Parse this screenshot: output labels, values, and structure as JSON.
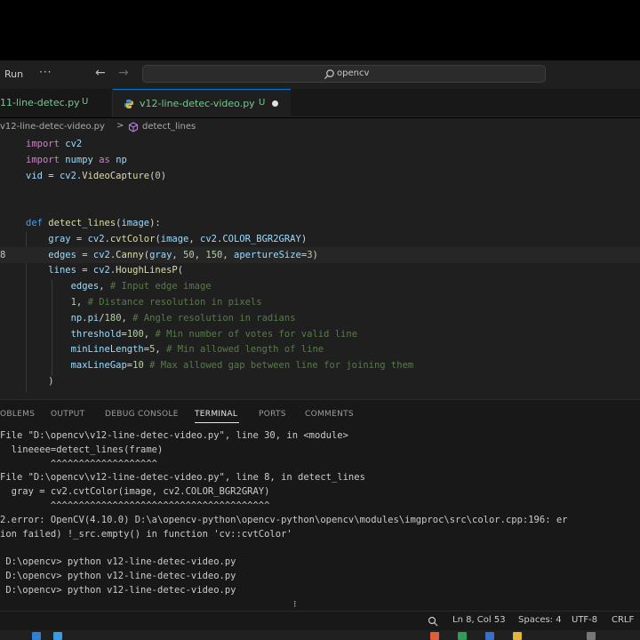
{
  "topbar": {
    "menu_run": "Run",
    "menu_more": "···",
    "nav_back": "←",
    "nav_forward": "→",
    "search_text": "opencv"
  },
  "tabs": [
    {
      "label": "11-line-detec.py",
      "status": "U"
    },
    {
      "label": "v12-line-detec-video.py",
      "status": "U"
    }
  ],
  "breadcrumb": {
    "file": "v12-line-detec-video.py",
    "sep": ">",
    "symbol": "detect_lines"
  },
  "code_lines": [
    {
      "num": "",
      "html": "<span class=\"kw\">import</span> <span class=\"var\">cv2</span>"
    },
    {
      "num": "",
      "html": "<span class=\"kw\">import</span> <span class=\"var\">numpy</span> <span class=\"kw\">as</span> <span class=\"var\">np</span>"
    },
    {
      "num": "",
      "html": "<span class=\"var\">vid</span> = <span class=\"var\">cv2</span>.<span class=\"fn\">VideoCapture</span>(<span class=\"num\">0</span>)"
    },
    {
      "num": "",
      "html": ""
    },
    {
      "num": "",
      "html": ""
    },
    {
      "num": "",
      "html": "<span class=\"kw2\">def</span> <span class=\"fn\">detect_lines</span>(<span class=\"var\">image</span>):"
    },
    {
      "num": "",
      "html": "    <span class=\"var\">gray</span> = <span class=\"var\">cv2</span>.<span class=\"fn\">cvtColor</span>(<span class=\"var\">image</span>, <span class=\"var\">cv2</span>.<span class=\"var\">COLOR_BGR2GRAY</span>)"
    },
    {
      "num": "8",
      "html": "    <span class=\"var\">edges</span> = <span class=\"var\">cv2</span>.<span class=\"fn\">Canny</span>(<span class=\"var\">gray</span>, <span class=\"num\">50</span>, <span class=\"num\">150</span>, <span class=\"var\">apertureSize</span>=<span class=\"num\">3</span>)"
    },
    {
      "num": "",
      "html": "    <span class=\"var\">lines</span> = <span class=\"var\">cv2</span>.<span class=\"fn\">HoughLinesP</span>("
    },
    {
      "num": "",
      "html": "        <span class=\"var\">edges</span>, <span class=\"cm\"># Input edge image</span>"
    },
    {
      "num": "",
      "html": "        <span class=\"num\">1</span>, <span class=\"cm\"># Distance resolution in pixels</span>"
    },
    {
      "num": "",
      "html": "        <span class=\"var\">np</span>.<span class=\"var\">pi</span>/<span class=\"num\">180</span>, <span class=\"cm\"># Angle resolution in radians</span>"
    },
    {
      "num": "",
      "html": "        <span class=\"var\">threshold</span>=<span class=\"num\">100</span>, <span class=\"cm\"># Min number of votes for valid line</span>"
    },
    {
      "num": "",
      "html": "        <span class=\"var\">minLineLength</span>=<span class=\"num\">5</span>, <span class=\"cm\"># Min allowed length of line</span>"
    },
    {
      "num": "",
      "html": "        <span class=\"var\">maxLineGap</span>=<span class=\"num\">10</span> <span class=\"cm\"># Max allowed gap between line for joining them</span>"
    },
    {
      "num": "",
      "html": "    )"
    }
  ],
  "panel_tabs": [
    {
      "label": "OBLEMS",
      "active": false
    },
    {
      "label": "OUTPUT",
      "active": false
    },
    {
      "label": "DEBUG CONSOLE",
      "active": false
    },
    {
      "label": "TERMINAL",
      "active": true
    },
    {
      "label": "PORTS",
      "active": false
    },
    {
      "label": "COMMENTS",
      "active": false
    }
  ],
  "terminal_lines": [
    "File \"D:\\opencv\\v12-line-detec-video.py\", line 30, in <module>",
    "  lineeee=detect_lines(frame)",
    "         ^^^^^^^^^^^^^^^^^^^",
    "File \"D:\\opencv\\v12-line-detec-video.py\", line 8, in detect_lines",
    "  gray = cv2.cvtColor(image, cv2.COLOR_BGR2GRAY)",
    "         ^^^^^^^^^^^^^^^^^^^^^^^^^^^^^^^^^^^^^^^",
    "2.error: OpenCV(4.10.0) D:\\a\\opencv-python\\opencv-python\\opencv\\modules\\imgproc\\src\\color.cpp:196: er",
    "ion failed) !_src.empty() in function 'cv::cvtColor'",
    "",
    " D:\\opencv> python v12-line-detec-video.py",
    " D:\\opencv> python v12-line-detec-video.py",
    " D:\\opencv> python v12-line-detec-video.py"
  ],
  "terminal_cursor": "⁝",
  "statusbar": {
    "position": "Ln 8, Col 53",
    "spaces": "Spaces: 4",
    "encoding": "UTF-8",
    "eol": "CRLF"
  },
  "colors": {
    "accent": "#0078d4",
    "untracked_green": "#73c991",
    "editor_bg": "#1f1f1f"
  }
}
